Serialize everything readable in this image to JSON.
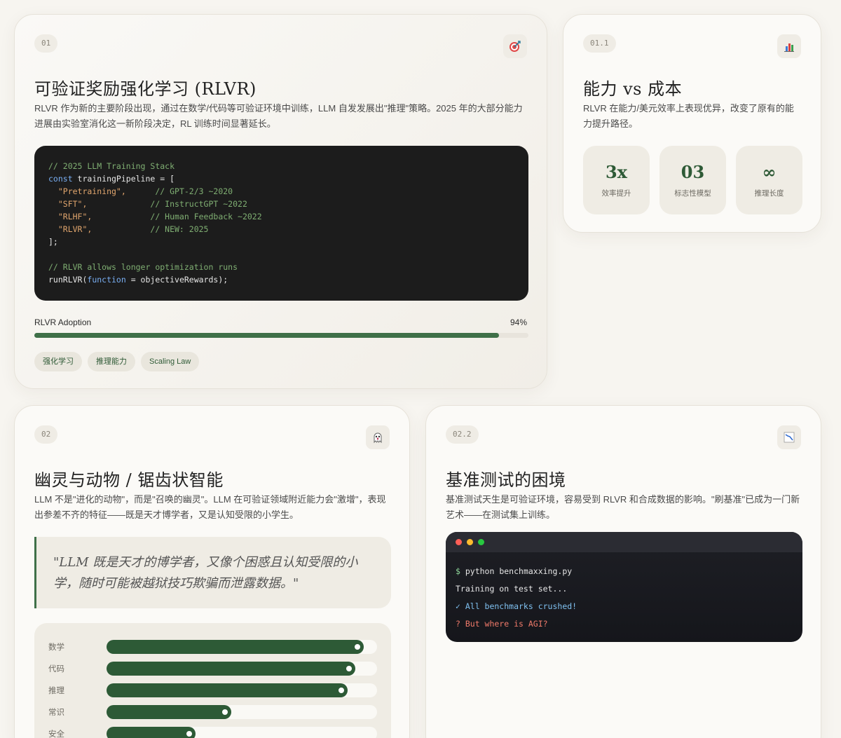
{
  "card1": {
    "number": "01",
    "icon": "target-icon",
    "title": "可验证奖励强化学习 (RLVR)",
    "description": "RLVR 作为新的主要阶段出现，通过在数学/代码等可验证环境中训练，LLM 自发发展出\"推理\"策略。2025 年的大部分能力进展由实验室消化这一新阶段决定，RL 训练时间显著延长。",
    "code": {
      "line1": "// 2025 LLM Training Stack",
      "line2_kw": "const",
      "line2_rest": " trainingPipeline = [",
      "line3_str": "  \"Pretraining\",",
      "line3_com": "      // GPT-2/3 ~2020",
      "line4_str": "  \"SFT\",",
      "line4_com": "             // InstructGPT ~2022",
      "line5_str": "  \"RLHF\",",
      "line5_com": "            // Human Feedback ~2022",
      "line6_str": "  \"RLVR\",",
      "line6_com": "            // NEW: 2025",
      "line7": "];",
      "line9": "// RLVR allows longer optimization runs",
      "line10_a": "runRLVR(",
      "line10_kw": "function",
      "line10_b": " = objectiveRewards);"
    },
    "progress": {
      "label": "RLVR Adoption",
      "value_text": "94%",
      "value": 0.94
    },
    "tags": [
      "强化学习",
      "推理能力",
      "Scaling Law"
    ]
  },
  "card2": {
    "number": "01.1",
    "icon": "bar-chart-icon",
    "title": "能力 vs 成本",
    "description": "RLVR 在能力/美元效率上表现优异，改变了原有的能力提升路径。",
    "stats": [
      {
        "value": "3x",
        "label": "效率提升"
      },
      {
        "value": "03",
        "label": "标志性模型"
      },
      {
        "value": "∞",
        "label": "推理长度"
      }
    ]
  },
  "card3": {
    "number": "02",
    "icon": "ghost-icon",
    "title": "幽灵与动物 / 锯齿状智能",
    "description": "LLM 不是\"进化的动物\"，而是\"召唤的幽灵\"。LLM 在可验证领域附近能力会\"激增\"，表现出参差不齐的特征——既是天才博学者，又是认知受限的小学生。",
    "quote": "\"LLM 既是天才的博学者，又像个困惑且认知受限的小学，随时可能被越狱技巧欺骗而泄露数据。\"",
    "skills": [
      {
        "name": "数学",
        "level": 0.95
      },
      {
        "name": "代码",
        "level": 0.92
      },
      {
        "name": "推理",
        "level": 0.89
      },
      {
        "name": "常识",
        "level": 0.46
      },
      {
        "name": "安全",
        "level": 0.33
      }
    ]
  },
  "card4": {
    "number": "02.2",
    "icon": "chart-decreasing-icon",
    "title": "基准测试的困境",
    "description": "基准测试天生是可验证环境，容易受到 RLVR 和合成数据的影响。\"刷基准\"已成为一门新艺术——在测试集上训练。",
    "terminal": {
      "prompt": "$",
      "command": " python benchmaxxing.py",
      "line2": "Training on test set...",
      "line3": "✓ All benchmarks crushed!",
      "line4": "? But where is AGI?"
    }
  },
  "colors": {
    "accent": "#3f7048",
    "dark_green": "#2d5a36",
    "bg": "#f7f5f0"
  }
}
